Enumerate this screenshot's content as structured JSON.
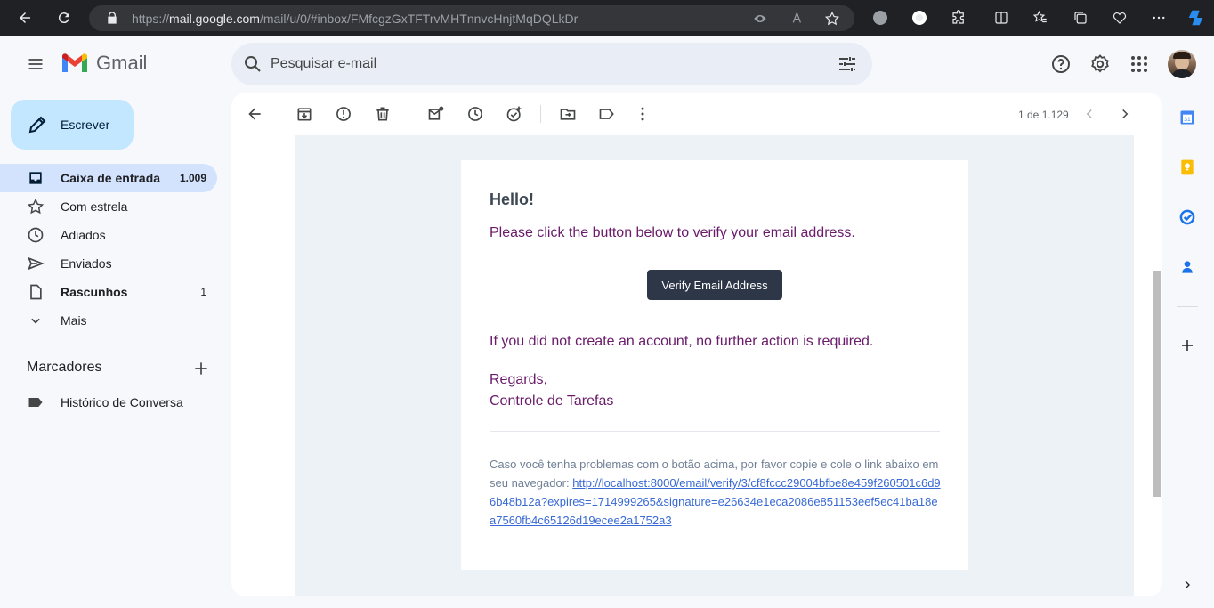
{
  "browser": {
    "url_prefix": "https://",
    "url_domain": "mail.google.com",
    "url_path": "/mail/u/0/#inbox/FMfcgzGxTFTrvMHTnnvcHnjtMqDQLkDr"
  },
  "header": {
    "app_name": "Gmail",
    "search_placeholder": "Pesquisar e-mail"
  },
  "compose": {
    "label": "Escrever"
  },
  "nav": [
    {
      "label": "Caixa de entrada",
      "count": "1.009",
      "icon": "inbox-icon",
      "active": true,
      "bold": true
    },
    {
      "label": "Com estrela",
      "count": "",
      "icon": "star-icon"
    },
    {
      "label": "Adiados",
      "count": "",
      "icon": "clock-icon"
    },
    {
      "label": "Enviados",
      "count": "",
      "icon": "send-icon"
    },
    {
      "label": "Rascunhos",
      "count": "1",
      "icon": "draft-icon",
      "bold": true
    },
    {
      "label": "Mais",
      "count": "",
      "icon": "chevron-down-icon"
    }
  ],
  "labels": {
    "title": "Marcadores",
    "items": [
      {
        "label": "Histórico de Conversa",
        "icon": "label-icon"
      }
    ]
  },
  "toolbar": {
    "page_count": "1 de 1.129"
  },
  "email": {
    "greeting": "Hello!",
    "intro": "Please click the button below to verify your email address.",
    "button_label": "Verify Email Address",
    "outro": "If you did not create an account, no further action is required.",
    "regards": "Regards,",
    "sender": "Controle de Tarefas",
    "subcopy_text": "Caso você tenha problemas com o botão acima, por favor copie e cole o link abaixo em seu navegador:",
    "subcopy_link": "http://localhost:8000/email/verify/3/cf8fccc29004bfbe8e459f260501c6d96b48b12a?expires=1714999265&signature=e26634e1eca2086e851153eef5ec41ba18ea7560fb4c65126d19ecee2a1752a3"
  },
  "colors": {
    "compose_bg": "#c2e7ff",
    "active_nav": "#d3e3fd",
    "email_text": "#6a1b6a",
    "button_bg": "#2d3748",
    "link": "#3869d4"
  }
}
